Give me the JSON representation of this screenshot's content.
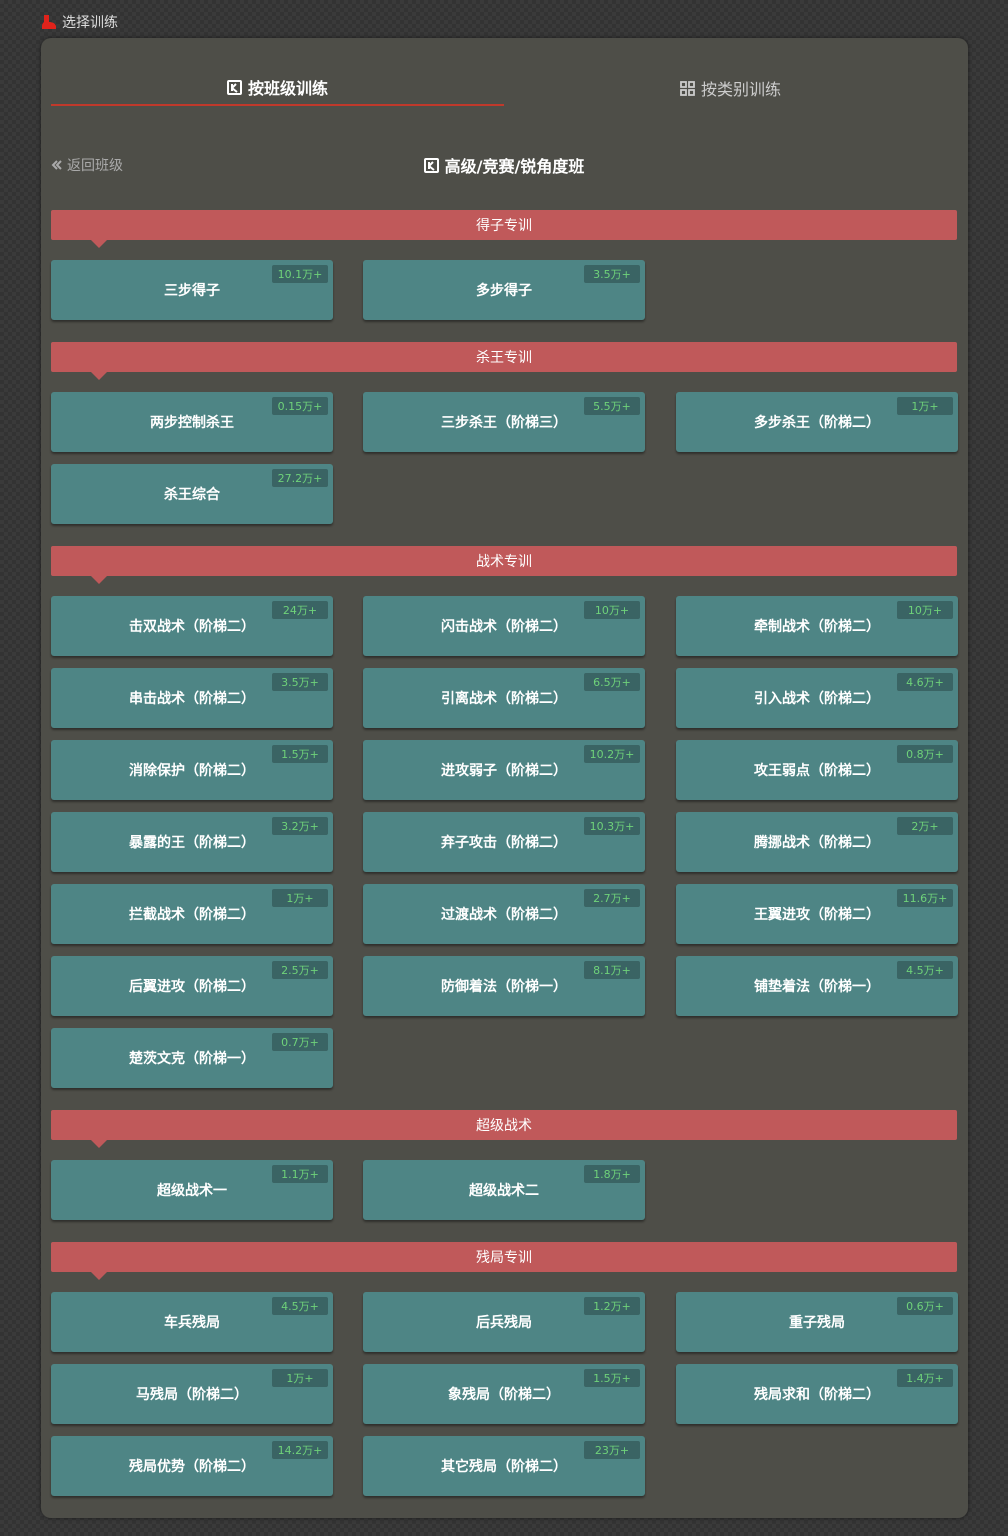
{
  "top": {
    "label": "选择训练",
    "icon": "boot-icon",
    "accent": "#e0231b"
  },
  "tabs": [
    {
      "label": "按班级训练",
      "icon": "class-icon",
      "active": true
    },
    {
      "label": "按类别训练",
      "icon": "grid-icon",
      "active": false
    }
  ],
  "back_label": "返回班级",
  "class_title": "高级/竞赛/锐角度班",
  "sections": [
    {
      "title": "得子专训",
      "items": [
        {
          "name": "三步得子",
          "count": "10.1万+"
        },
        {
          "name": "多步得子",
          "count": "3.5万+"
        }
      ]
    },
    {
      "title": "杀王专训",
      "items": [
        {
          "name": "两步控制杀王",
          "count": "0.15万+"
        },
        {
          "name": "三步杀王（阶梯三）",
          "count": "5.5万+"
        },
        {
          "name": "多步杀王（阶梯二）",
          "count": "1万+"
        },
        {
          "name": "杀王综合",
          "count": "27.2万+"
        }
      ]
    },
    {
      "title": "战术专训",
      "items": [
        {
          "name": "击双战术（阶梯二）",
          "count": "24万+"
        },
        {
          "name": "闪击战术（阶梯二）",
          "count": "10万+"
        },
        {
          "name": "牵制战术（阶梯二）",
          "count": "10万+"
        },
        {
          "name": "串击战术（阶梯二）",
          "count": "3.5万+"
        },
        {
          "name": "引离战术（阶梯二）",
          "count": "6.5万+"
        },
        {
          "name": "引入战术（阶梯二）",
          "count": "4.6万+"
        },
        {
          "name": "消除保护（阶梯二）",
          "count": "1.5万+"
        },
        {
          "name": "进攻弱子（阶梯二）",
          "count": "10.2万+"
        },
        {
          "name": "攻王弱点（阶梯二）",
          "count": "0.8万+"
        },
        {
          "name": "暴露的王（阶梯二）",
          "count": "3.2万+"
        },
        {
          "name": "弃子攻击（阶梯二）",
          "count": "10.3万+"
        },
        {
          "name": "腾挪战术（阶梯二）",
          "count": "2万+"
        },
        {
          "name": "拦截战术（阶梯二）",
          "count": "1万+"
        },
        {
          "name": "过渡战术（阶梯二）",
          "count": "2.7万+"
        },
        {
          "name": "王翼进攻（阶梯二）",
          "count": "11.6万+"
        },
        {
          "name": "后翼进攻（阶梯二）",
          "count": "2.5万+"
        },
        {
          "name": "防御着法（阶梯一）",
          "count": "8.1万+"
        },
        {
          "name": "铺垫着法（阶梯一）",
          "count": "4.5万+"
        },
        {
          "name": "楚茨文克（阶梯一）",
          "count": "0.7万+"
        }
      ]
    },
    {
      "title": "超级战术",
      "items": [
        {
          "name": "超级战术一",
          "count": "1.1万+"
        },
        {
          "name": "超级战术二",
          "count": "1.8万+"
        }
      ]
    },
    {
      "title": "残局专训",
      "items": [
        {
          "name": "车兵残局",
          "count": "4.5万+"
        },
        {
          "name": "后兵残局",
          "count": "1.2万+"
        },
        {
          "name": "重子残局",
          "count": "0.6万+"
        },
        {
          "name": "马残局（阶梯二）",
          "count": "1万+"
        },
        {
          "name": "象残局（阶梯二）",
          "count": "1.5万+"
        },
        {
          "name": "残局求和（阶梯二）",
          "count": "1.4万+"
        },
        {
          "name": "残局优势（阶梯二）",
          "count": "14.2万+"
        },
        {
          "name": "其它残局（阶梯二）",
          "count": "23万+"
        }
      ]
    }
  ]
}
